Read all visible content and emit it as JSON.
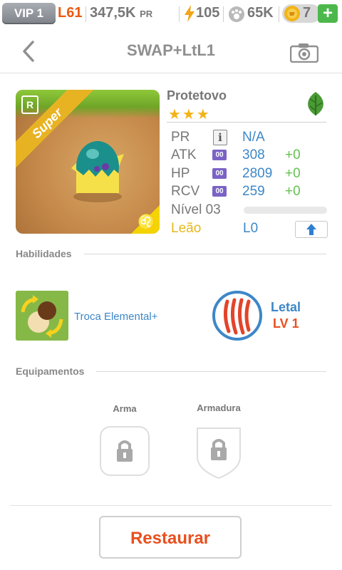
{
  "status_bar": {
    "vip": "VIP 1",
    "level": "L61",
    "power": "347,5K",
    "power_unit": "PR",
    "energy": "105",
    "paw_coins": "65K",
    "gems": "7",
    "add_label": "+"
  },
  "header": {
    "title": "SWAP+LtL1",
    "back_icon": "chevron-left-icon",
    "camera_icon": "camera-icon"
  },
  "monster": {
    "name": "Protetovo",
    "stars": "★★★",
    "element_icon": "leaf-icon",
    "rarity": "R",
    "tag": "Super",
    "zodiac_icon": "leo-sign-icon",
    "zodiac_symbol": "♌",
    "stats": [
      {
        "label": "PR",
        "value": "N/A",
        "bonus": ""
      },
      {
        "label": "ATK",
        "value": "308",
        "bonus": "+0"
      },
      {
        "label": "HP",
        "value": "2809",
        "bonus": "+0"
      },
      {
        "label": "RCV",
        "value": "259",
        "bonus": "+0"
      }
    ],
    "stat_badge": "00",
    "info_badge": "i",
    "level_label": "Nível 03",
    "level_progress": 0,
    "sign_label": "Leão",
    "sign_level": "L0",
    "colors": {
      "value": "#3d87c8",
      "bonus": "#64c24f",
      "sign": "#e7b71b"
    }
  },
  "abilities": {
    "section_title": "Habilidades",
    "skill": {
      "name": "Troca Elemental+"
    },
    "trait": {
      "name": "Letal",
      "level": "LV 1"
    }
  },
  "equipment": {
    "section_title": "Equipamentos",
    "slots": [
      {
        "label": "Arma",
        "icon": "lock-icon"
      },
      {
        "label": "Armadura",
        "icon": "lock-icon"
      }
    ]
  },
  "footer": {
    "restore_label": "Restaurar"
  }
}
